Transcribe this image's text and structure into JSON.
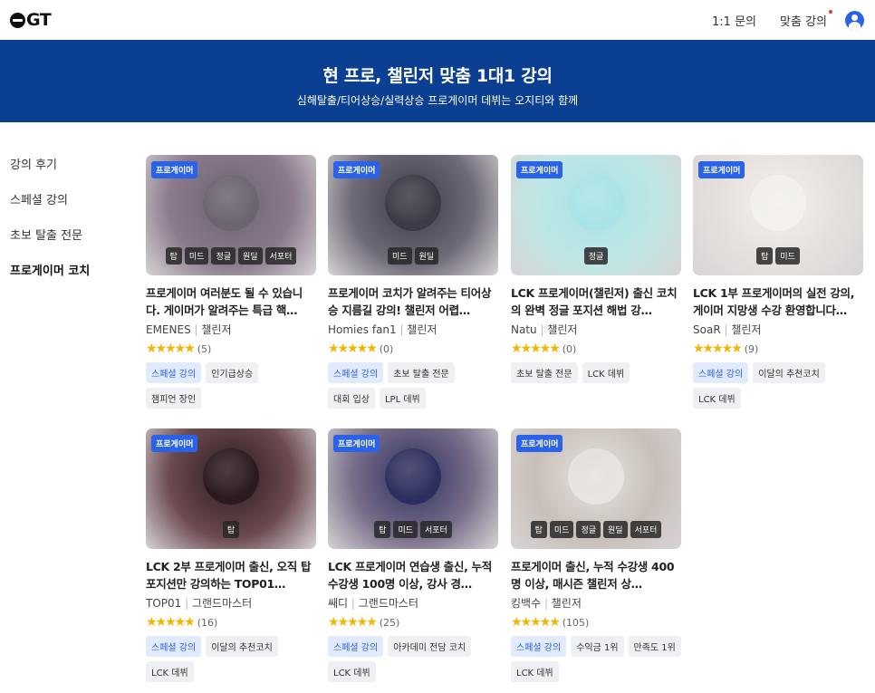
{
  "header": {
    "logo": "GT",
    "nav": [
      {
        "label": "1:1 문의"
      },
      {
        "label": "맞춤 강의"
      }
    ]
  },
  "banner": {
    "title": "현 프로, 챌린저 맞춤 1대1 강의",
    "subtitle": "심해탈출/티어상승/실력상승 프로게이머 데뷔는 오지티와 함께"
  },
  "sidebar": {
    "items": [
      {
        "label": "강의 후기"
      },
      {
        "label": "스페셜 강의"
      },
      {
        "label": "초보 탈출 전문"
      },
      {
        "label": "프로게이머 코치",
        "active": true
      }
    ]
  },
  "cards": [
    {
      "badge": "프로게이머",
      "positions": [
        "탑",
        "미드",
        "정글",
        "원딜",
        "서포터"
      ],
      "title": "프로게이머 여러분도 될 수 있습니다. 게이머가 알려주는 특급 핵…",
      "coach": "EMENES",
      "tier": "챌린저",
      "stars": "★★★★★",
      "reviews": "(5)",
      "tags": [
        {
          "label": "스페셜 강의",
          "highlight": true
        },
        {
          "label": "인기급상승"
        },
        {
          "label": "챔피언 장인"
        }
      ],
      "bg_color": "#8a7a8c",
      "circle_color": "#6c6470"
    },
    {
      "badge": "프로게이머",
      "positions": [
        "미드",
        "원딜"
      ],
      "title": "프로게이머 코치가 알려주는 티어상승 지름길 강의! 챌린저 어렵…",
      "coach": "Homies fan1",
      "tier": "챌린저",
      "stars": "★★★★★",
      "reviews": "(0)",
      "tags": [
        {
          "label": "스페셜 강의",
          "highlight": true
        },
        {
          "label": "초보 탈출 전문"
        },
        {
          "label": "대회 입상"
        },
        {
          "label": "LPL 데뷔"
        }
      ],
      "bg_color": "#6f6a78",
      "circle_color": "#3c3a45"
    },
    {
      "badge": "프로게이머",
      "positions": [
        "정글"
      ],
      "title": "LCK 프로게이머(챌린저) 출신 코치의 완벽 정글 포지션 해법 강…",
      "coach": "Natu",
      "tier": "챌린저",
      "stars": "★★★★★",
      "reviews": "(0)",
      "tags": [
        {
          "label": "초보 탈출 전문"
        },
        {
          "label": "LCK 데뷔"
        }
      ],
      "bg_color": "#bfe6e4",
      "circle_color": "#a8e3e8"
    },
    {
      "badge": "프로게이머",
      "positions": [
        "탑",
        "미드"
      ],
      "title": "LCK 1부 프로게이머의 실전 강의, 게이머 지망생 수강 환영합니다…",
      "coach": "SoaR",
      "tier": "챌린저",
      "stars": "★★★★★",
      "reviews": "(9)",
      "tags": [
        {
          "label": "스페셜 강의",
          "highlight": true
        },
        {
          "label": "이달의 추천코치"
        },
        {
          "label": "LCK 데뷔"
        }
      ],
      "bg_color": "#e6e0dc",
      "circle_color": "#f3f0ee"
    },
    {
      "badge": "프로게이머",
      "positions": [
        "탑"
      ],
      "title": "LCK 2부 프로게이머 출신, 오직 탑 포지션만 강의하는 TOP01…",
      "coach": "TOP01",
      "tier": "그랜드마스터",
      "stars": "★★★★★",
      "reviews": "(16)",
      "tags": [
        {
          "label": "스페셜 강의",
          "highlight": true
        },
        {
          "label": "이달의 추천코치"
        },
        {
          "label": "LCK 데뷔"
        }
      ],
      "bg_color": "#6b4a50",
      "circle_color": "#2a1a1e"
    },
    {
      "badge": "프로게이머",
      "positions": [
        "탑",
        "미드",
        "서포터"
      ],
      "title": "LCK 프로게이머 연습생 출신, 누적 수강생 100명 이상, 강사 경…",
      "coach": "쌔디",
      "tier": "그랜드마스터",
      "stars": "★★★★★",
      "reviews": "(25)",
      "tags": [
        {
          "label": "스페셜 강의",
          "highlight": true
        },
        {
          "label": "아카데미 전담 코치"
        },
        {
          "label": "LCK 데뷔"
        }
      ],
      "bg_color": "#7a6e8a",
      "circle_color": "#2c2f5e"
    },
    {
      "badge": "프로게이머",
      "positions": [
        "탑",
        "미드",
        "정글",
        "원딜",
        "서포터"
      ],
      "title": "프로게이머 출신, 누적 수강생 400명 이상, 매시즌 챌린저 상…",
      "coach": "킹백수",
      "tier": "챌린저",
      "stars": "★★★★★",
      "reviews": "(105)",
      "tags": [
        {
          "label": "스페셜 강의",
          "highlight": true
        },
        {
          "label": "수익금 1위"
        },
        {
          "label": "만족도 1위"
        },
        {
          "label": "LCK 데뷔"
        }
      ],
      "bg_color": "#c8bfb8",
      "circle_color": "#e8e4e0"
    }
  ]
}
